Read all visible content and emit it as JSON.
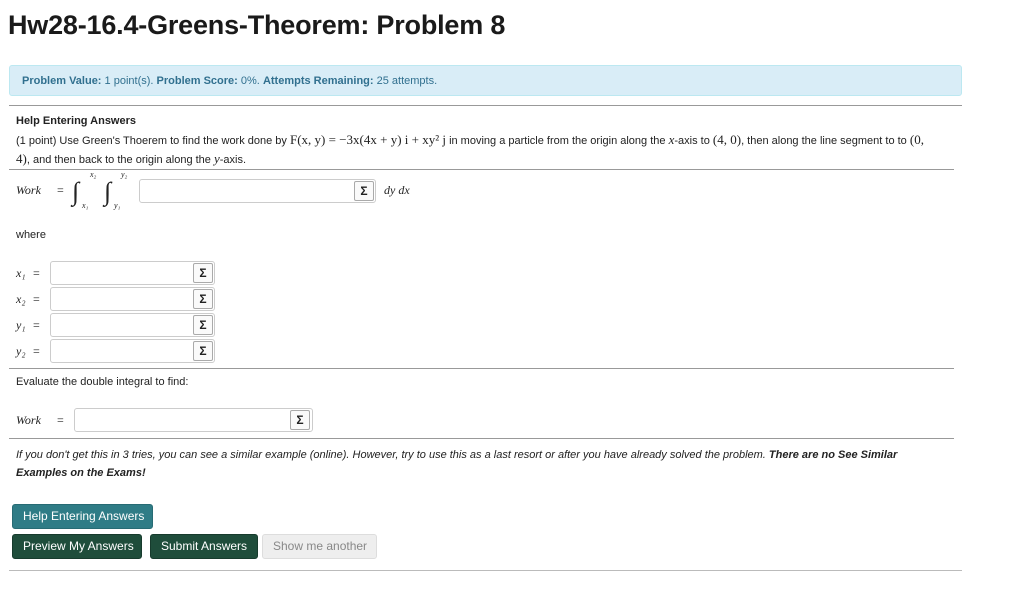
{
  "page_title": "Hw28-16.4-Greens-Theorem: Problem 8",
  "info_bar": {
    "value_label": "Problem Value:",
    "value_text": "1 point(s).",
    "score_label": "Problem Score:",
    "score_text": "0%.",
    "attempts_label": "Attempts Remaining:",
    "attempts_text": "25 attempts."
  },
  "help_heading": "Help Entering Answers",
  "problem": {
    "intro": "(1 point) Use Green's Thoerem to find the work done by",
    "field": "F(x, y) = −3x(4x + y) i + xy² j",
    "mid": "in moving a particle from the origin along the",
    "axis_x": "x",
    "mid2": "-axis to",
    "point1": "(4, 0)",
    "mid3": ", then along the line segment to to",
    "point2": "(0, 4)",
    "mid4": ", and then back to the origin along the",
    "axis_y": "y",
    "end": "-axis."
  },
  "integral": {
    "work_label": "Work",
    "equals": "=",
    "sign": "∫",
    "lower_outer": "x₁",
    "upper_outer": "x₂",
    "lower_inner": "y₁",
    "upper_inner": "y₂",
    "differentials": "dy dx",
    "integrand_value": ""
  },
  "where_label": "where",
  "vars": [
    {
      "label": "x₁",
      "equals": "=",
      "value": ""
    },
    {
      "label": "x₂",
      "equals": "=",
      "value": ""
    },
    {
      "label": "y₁",
      "equals": "=",
      "value": ""
    },
    {
      "label": "y₂",
      "equals": "=",
      "value": ""
    }
  ],
  "evaluate_text": "Evaluate the double integral to find:",
  "final": {
    "work_label": "Work",
    "equals": "=",
    "value": ""
  },
  "sigma_symbol": "Σ",
  "note": {
    "text": "If you don't get this in 3 tries, you can see a similar example (online). However, try to use this as a last resort or after you have already solved the problem.",
    "bold": "There are no See Similar Examples on the Exams!"
  },
  "buttons": {
    "help": "Help Entering Answers",
    "preview": "Preview My Answers",
    "submit": "Submit Answers",
    "show_another": "Show me another"
  },
  "colors": {
    "info_bg": "#d9edf7",
    "info_text": "#31708f",
    "teal_button": "#2f7c86",
    "dark_button": "#1f4d3b"
  }
}
